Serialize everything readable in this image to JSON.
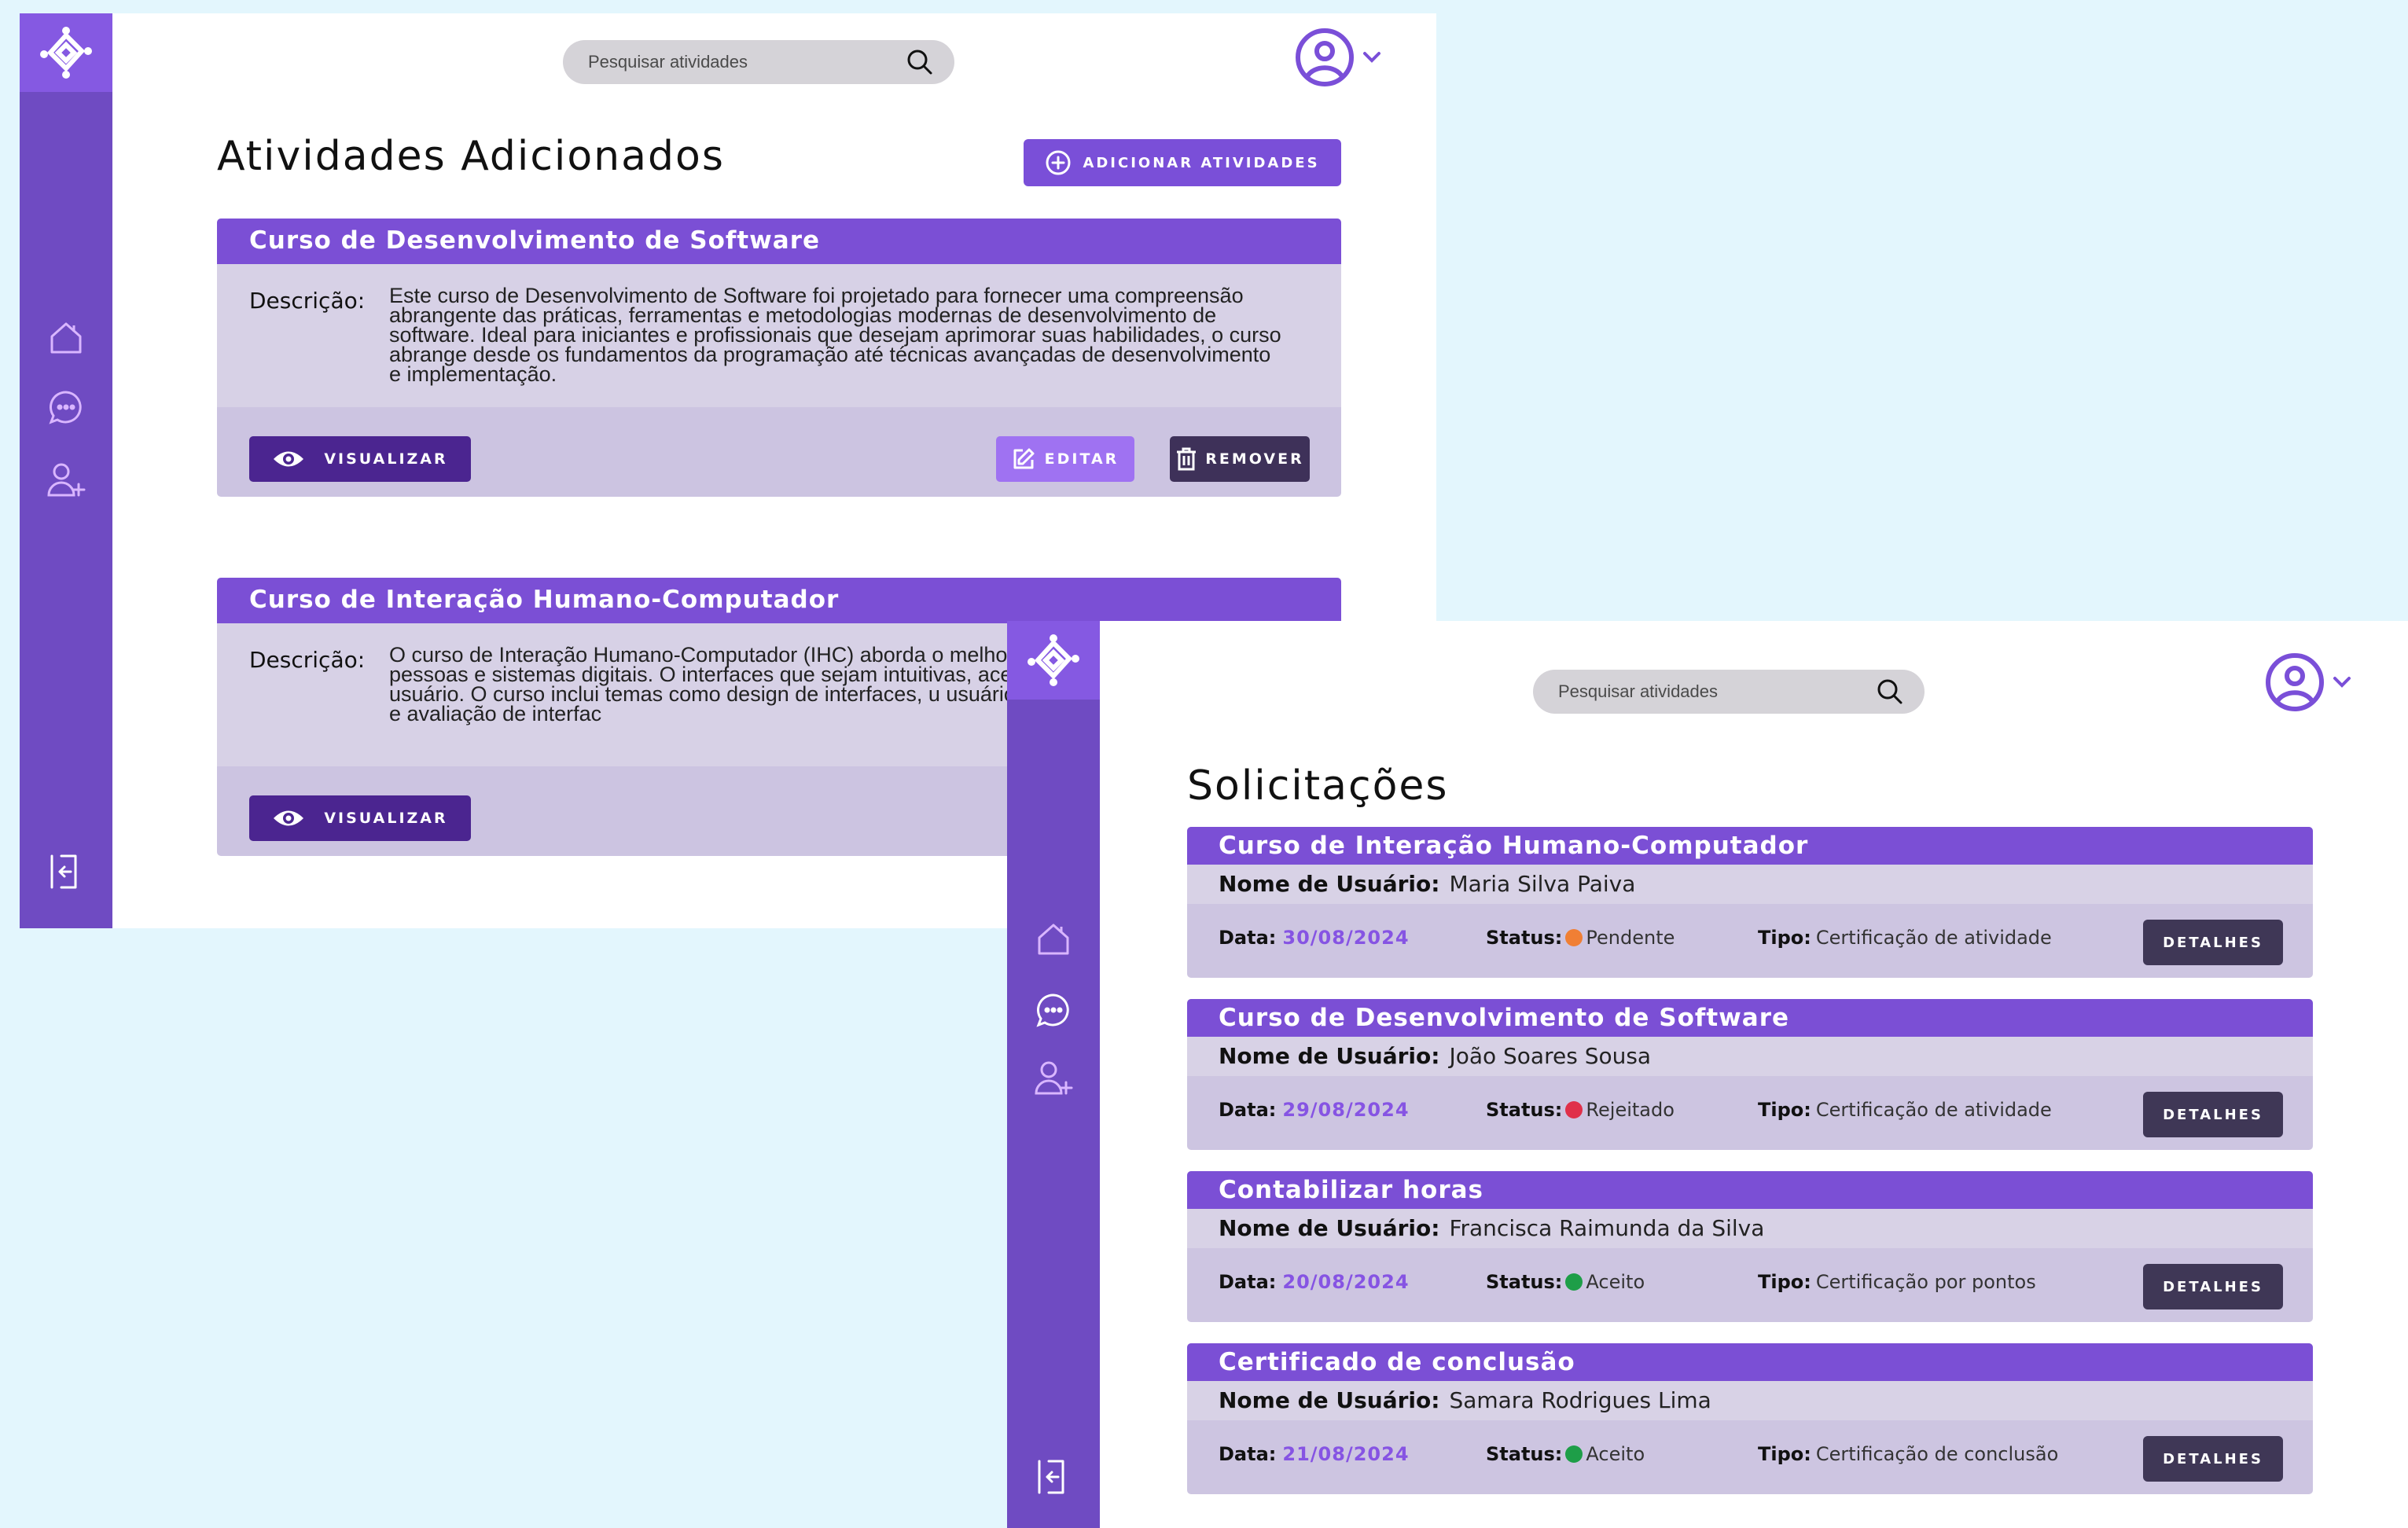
{
  "colors": {
    "sidebar": "#6f4bc2",
    "accent": "#7b4fd5",
    "background": "#e3f6fd",
    "status_pending": "#f07f34",
    "status_rejected": "#e0304a",
    "status_accepted": "#1e9e48"
  },
  "screen1": {
    "search": {
      "placeholder": "Pesquisar atividades"
    },
    "title": "Atividades Adicionados",
    "add_button": "ADICIONAR ATIVIDADES",
    "cards": [
      {
        "title": "Curso de Desenvolvimento de Software",
        "desc_label": "Descrição:",
        "description": "Este curso de Desenvolvimento de Software foi projetado para fornecer uma compreensão abrangente das práticas, ferramentas e metodologias modernas de desenvolvimento de software. Ideal para iniciantes e profissionais que desejam aprimorar suas habilidades, o curso abrange desde os fundamentos da programação até técnicas avançadas de desenvolvimento e implementação.",
        "view": "VISUALIZAR",
        "edit": "EDITAR",
        "remove": "REMOVER"
      },
      {
        "title": "Curso de Interação Humano-Computador",
        "desc_label": "Descrição:",
        "description": "O curso de Interação Humano-Computador (IHC) aborda o melhoram a interação entre pessoas e sistemas digitais. O interfaces que sejam intuitivas, acessíveis e eficazes, utiliz usuário. O curso inclui temas como design de interfaces, u usuário (UX), acessibilidade digital, e avaliação de interfac",
        "view": "VISUALIZAR"
      }
    ]
  },
  "screen2": {
    "search": {
      "placeholder": "Pesquisar atividades"
    },
    "title": "Solicitações",
    "labels": {
      "user": "Nome de Usuário:",
      "date": "Data:",
      "status": "Status:",
      "type": "Tipo:",
      "details": "DETALHES"
    },
    "requests": [
      {
        "title": "Curso de Interação Humano-Computador",
        "user": "Maria Silva Paiva",
        "date": "30/08/2024",
        "status": "Pendente",
        "status_color": "#f07f34",
        "type": "Certificação de atividade"
      },
      {
        "title": "Curso de Desenvolvimento de Software",
        "user": "João Soares Sousa",
        "date": "29/08/2024",
        "status": "Rejeitado",
        "status_color": "#e0304a",
        "type": "Certificação de atividade"
      },
      {
        "title": "Contabilizar horas",
        "user": "Francisca Raimunda da Silva",
        "date": "20/08/2024",
        "status": "Aceito",
        "status_color": "#1e9e48",
        "type": "Certificação por pontos"
      },
      {
        "title": "Certificado de conclusão",
        "user": "Samara Rodrigues Lima",
        "date": "21/08/2024",
        "status": "Aceito",
        "status_color": "#1e9e48",
        "type": "Certificação de conclusão"
      }
    ]
  }
}
